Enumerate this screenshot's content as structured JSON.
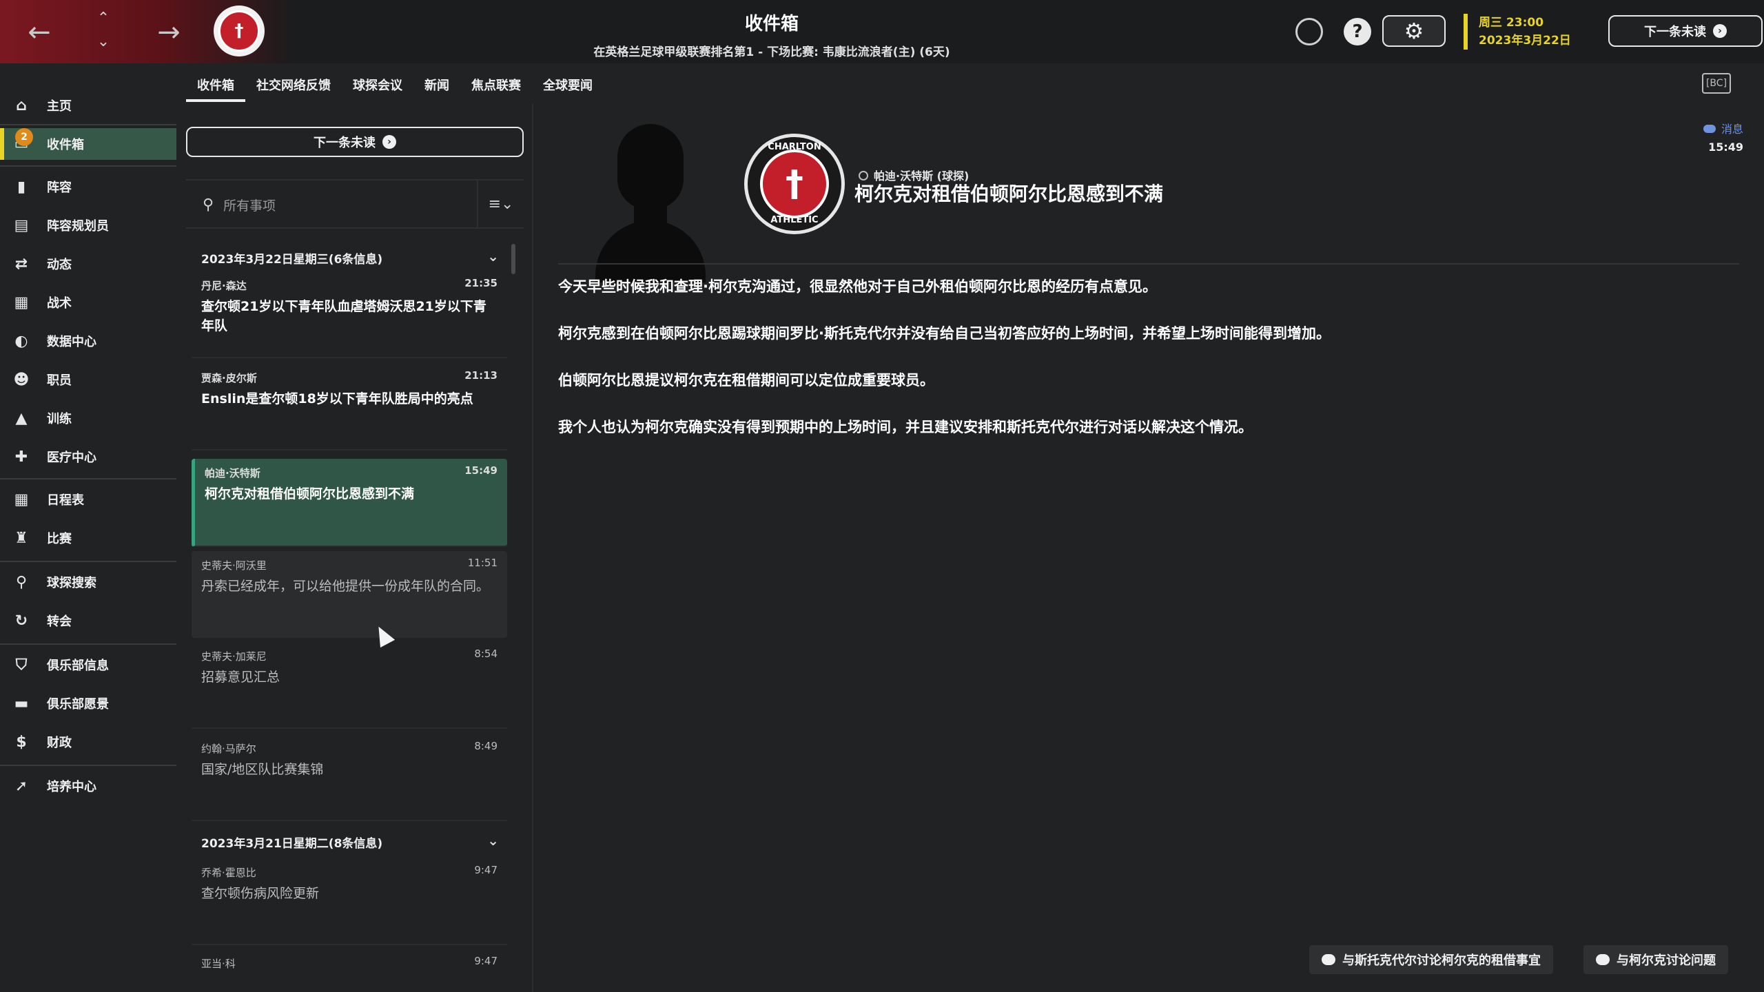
{
  "header": {
    "title": "收件箱",
    "subtitle": "在英格兰足球甲级联赛排名第1 - 下场比赛: 韦康比流浪者(主) (6天)",
    "back_icon": "arrow-left-icon",
    "forward_icon": "arrow-right-icon",
    "date_line1": "周三 23:00",
    "date_line2": "2023年3月22日",
    "next_unread": "下一条未读",
    "help_glyph": "?",
    "settings_glyph": "⚙"
  },
  "sidebar": {
    "items": [
      {
        "label": "主页",
        "icon": "home-icon"
      },
      {
        "label": "收件箱",
        "icon": "inbox-icon",
        "badge": "2"
      },
      {
        "label": "阵容",
        "icon": "squad-icon"
      },
      {
        "label": "阵容规划员",
        "icon": "clipboard-icon"
      },
      {
        "label": "动态",
        "icon": "dynamics-icon"
      },
      {
        "label": "战术",
        "icon": "tactics-icon"
      },
      {
        "label": "数据中心",
        "icon": "data-hub-icon"
      },
      {
        "label": "职员",
        "icon": "staff-icon"
      },
      {
        "label": "训练",
        "icon": "training-icon"
      },
      {
        "label": "医疗中心",
        "icon": "medical-icon"
      },
      {
        "label": "日程表",
        "icon": "calendar-icon"
      },
      {
        "label": "比赛",
        "icon": "trophy-icon"
      },
      {
        "label": "球探搜索",
        "icon": "scouting-search-icon"
      },
      {
        "label": "转会",
        "icon": "transfers-icon"
      },
      {
        "label": "俱乐部信息",
        "icon": "club-shield-icon"
      },
      {
        "label": "俱乐部愿景",
        "icon": "vision-icon"
      },
      {
        "label": "财政",
        "icon": "finances-icon"
      },
      {
        "label": "培养中心",
        "icon": "development-icon"
      }
    ]
  },
  "tabs": [
    "收件箱",
    "社交网络反馈",
    "球探会议",
    "新闻",
    "焦点联赛",
    "全球要闻"
  ],
  "list": {
    "next_unread": "下一条未读",
    "search_placeholder": "所有事项",
    "groups": [
      {
        "header": "2023年3月22日星期三(6条信息)"
      },
      {
        "header": "2023年3月21日星期二(8条信息)"
      }
    ],
    "messages": [
      {
        "from": "丹尼·森达",
        "time": "21:35",
        "subject": "查尔顿21岁以下青年队血虐塔姆沃思21岁以下青年队"
      },
      {
        "from": "贾森·皮尔斯",
        "time": "21:13",
        "subject": "Enslin是查尔顿18岁以下青年队胜局中的亮点"
      },
      {
        "from": "帕迪·沃特斯",
        "time": "15:49",
        "subject": "柯尔克对租借伯顿阿尔比恩感到不满"
      },
      {
        "from": "史蒂夫·阿沃里",
        "time": "11:51",
        "subject": "丹索已经成年，可以给他提供一份成年队的合同。"
      },
      {
        "from": "史蒂夫·加莱尼",
        "time": "8:54",
        "subject": "招募意见汇总"
      },
      {
        "from": "约翰·马萨尔",
        "time": "8:49",
        "subject": "国家/地区队比赛集锦"
      },
      {
        "from": "乔希·霍恩比",
        "time": "9:47",
        "subject": "查尔顿伤病风险更新"
      },
      {
        "from": "亚当·科",
        "time": "9:47",
        "subject": ""
      }
    ]
  },
  "detail": {
    "sender": "帕迪·沃特斯 (球探)",
    "subject": "柯尔克对租借伯顿阿尔比恩感到不满",
    "tag": "消息",
    "time": "15:49",
    "crest_top": "CHARLTON",
    "crest_bottom": "ATHLETIC",
    "paragraphs": [
      "今天早些时候我和查理·柯尔克沟通过，很显然他对于自己外租伯顿阿尔比恩的经历有点意见。",
      "柯尔克感到在伯顿阿尔比恩踢球期间罗比·斯托克代尔并没有给自己当初答应好的上场时间，并希望上场时间能得到增加。",
      "伯顿阿尔比恩提议柯尔克在租借期间可以定位成重要球员。",
      "我个人也认为柯尔克确实没有得到预期中的上场时间，并且建议安排和斯托克代尔进行对话以解决这个情况。"
    ],
    "actions": [
      "与斯托克代尔讨论柯尔克的租借事宜",
      "与柯尔克讨论问题"
    ]
  },
  "colors": {
    "accent_yellow": "#e8d424",
    "selected_green": "#2f5646",
    "badge_orange": "#e08a1a",
    "club_red": "#c21f2b",
    "tag_blue": "#6f93e0"
  }
}
